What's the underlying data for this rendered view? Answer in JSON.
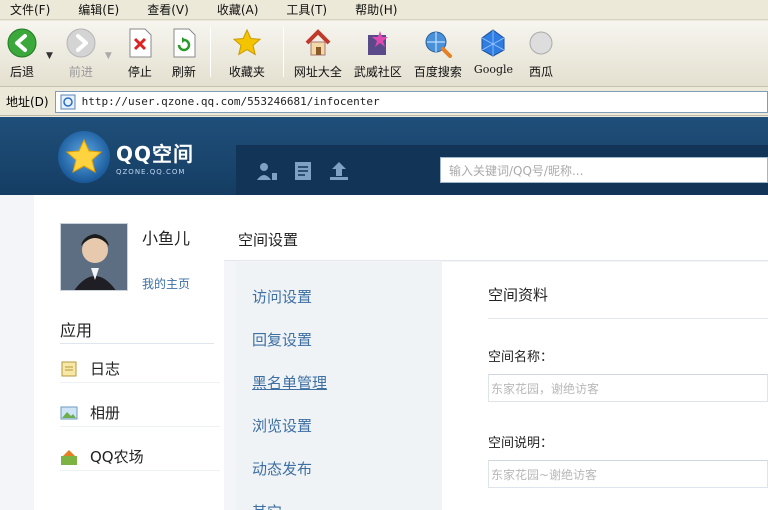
{
  "menu": {
    "items": [
      "文件(F)",
      "编辑(E)",
      "查看(V)",
      "收藏(A)",
      "工具(T)",
      "帮助(H)"
    ]
  },
  "toolbar": {
    "back": "后退",
    "forward": "前进",
    "stop": "停止",
    "refresh": "刷新",
    "favorites": "收藏夹",
    "sites": "网址大全",
    "community": "武威社区",
    "baidu": "百度搜索",
    "google": "Google",
    "more": "西瓜"
  },
  "address": {
    "label": "地址(D)",
    "url": "http://user.qzone.qq.com/553246681/infocenter"
  },
  "header": {
    "logo_text": "QQ空间",
    "logo_sub": "QZONE.QQ.COM",
    "search_placeholder": "输入关键词/QQ号/昵称..."
  },
  "profile": {
    "nickname": "小鱼儿",
    "home_link": "我的主页"
  },
  "apps": {
    "title": "应用",
    "items": [
      "日志",
      "相册",
      "QQ农场"
    ]
  },
  "settings": {
    "title": "空间设置",
    "items": [
      "访问设置",
      "回复设置",
      "黑名单管理",
      "浏览设置",
      "动态发布",
      "其它"
    ]
  },
  "panel": {
    "title": "空间资料",
    "name_label": "空间名称：",
    "name_value": "东家花园，谢绝访客",
    "desc_label": "空间说明：",
    "desc_value": "东家花园~谢绝访客"
  },
  "colors": {
    "header_bg": "#1f4f7a",
    "link": "#3d6fa3",
    "xp_chrome": "#ece9d8"
  }
}
